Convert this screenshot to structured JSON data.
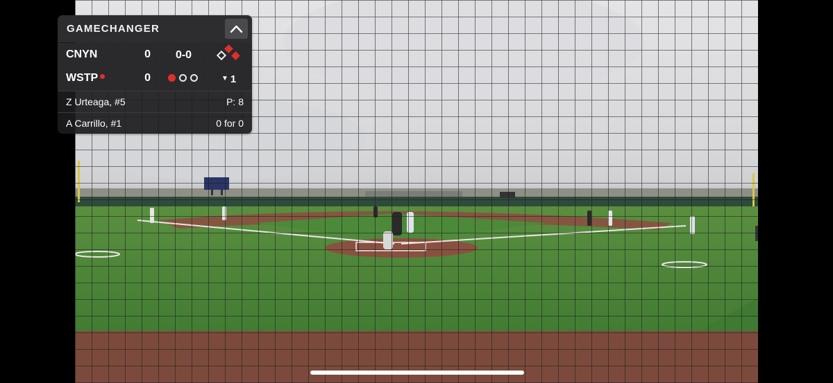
{
  "overlay": {
    "brand": "GAMECHANGER",
    "collapse_icon": "chevron-up-icon"
  },
  "teams": [
    {
      "name": "CNYN",
      "score": "0",
      "batting": false
    },
    {
      "name": "WSTP",
      "score": "0",
      "batting": true
    }
  ],
  "count": {
    "balls_strikes": "0-0",
    "outs_filled": 1,
    "outs_total": 3
  },
  "bases": {
    "first": true,
    "second": true,
    "third": false
  },
  "inning": {
    "half": "bottom",
    "indicator_icon": "triangle-down-icon",
    "number": "1"
  },
  "pitcher": {
    "name": "Z Urteaga, #5",
    "stat": "P: 8"
  },
  "batter": {
    "name": "A Carrillo, #1",
    "stat": "0 for 0"
  },
  "colors": {
    "accent_red": "#e0302a",
    "panel": "#2a2a2d",
    "field_green": "#4f8a3a",
    "infield_dirt": "#8a5040"
  }
}
